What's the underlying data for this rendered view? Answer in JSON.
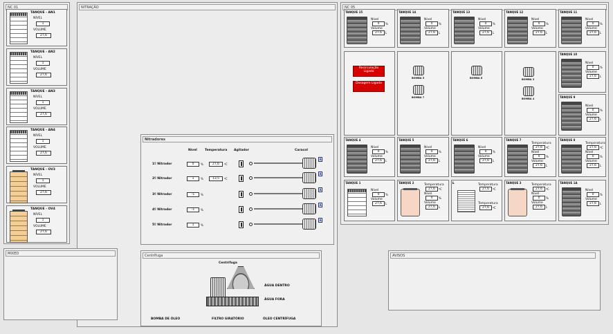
{
  "panels": {
    "left_title": "NC 01",
    "middle_title": "NITRAÇÃO",
    "right_title": "NC 05",
    "nitradores_title": "Nitradores",
    "centrifuga_title": "Centrífuga",
    "bottom_left_title": "MIXED",
    "avisos_title": "AVISOS"
  },
  "left_tanks": [
    {
      "name": "TANQUE - AN1",
      "nivel_label": "NÍVEL",
      "nivel": "1",
      "volume_label": "VOLUME",
      "volume": "27,6"
    },
    {
      "name": "TANQUE - AN2",
      "nivel_label": "NÍVEL",
      "nivel": "1",
      "volume_label": "VOLUME",
      "volume": "27,6"
    },
    {
      "name": "TANQUE - AN3",
      "nivel_label": "NÍVEL",
      "nivel": "1",
      "volume_label": "VOLUME",
      "volume": "27,6"
    },
    {
      "name": "TANQUE - AN4",
      "nivel_label": "NÍVEL",
      "nivel": "1",
      "volume_label": "VOLUME",
      "volume": "27,6"
    },
    {
      "name": "TANQUE - OV3",
      "nivel_label": "NÍVEL",
      "nivel": "1",
      "volume_label": "VOLUME",
      "volume": "27,6"
    },
    {
      "name": "TANQUE - OV4",
      "nivel_label": "NÍVEL",
      "nivel": "1",
      "volume_label": "VOLUME",
      "volume": "27,6"
    }
  ],
  "nitradores": {
    "col_nivel": "Nível",
    "col_temp": "Temperatura",
    "col_agit": "Agitador",
    "col_caracol": "Caracol",
    "rows": [
      {
        "label": "1º Nitrador",
        "nivel": "0",
        "nivel_unit": "%",
        "temp": "27,6",
        "temp_unit": "ºC",
        "a": "A"
      },
      {
        "label": "2º Nitrador",
        "nivel": "1",
        "nivel_unit": "%",
        "temp": "13,5",
        "temp_unit": "ºC",
        "a": "A"
      },
      {
        "label": "3º Nitrador",
        "nivel": "-1",
        "nivel_unit": "%",
        "temp": "",
        "temp_unit": "",
        "a": "A"
      },
      {
        "label": "4º Nitrador",
        "nivel": "-1",
        "nivel_unit": "%",
        "temp": "",
        "temp_unit": "",
        "a": "A"
      },
      {
        "label": "5º Nitrador",
        "nivel": "1",
        "nivel_unit": "%",
        "temp": "",
        "temp_unit": "",
        "a": "A"
      }
    ]
  },
  "centrifuga": {
    "label": "Centrífuga",
    "agua_dentro": "ÁGUA DENTRO",
    "agua_fora": "ÁGUA FORA",
    "bomba": "BOMBA DE ÓLEO",
    "filtro": "FILTRO GIRATÓRIO",
    "oleo": "ÓLEO CENTRÍFUGA"
  },
  "right": {
    "row1": [
      {
        "name": "TANQUE 15",
        "nivel_label": "Nível",
        "nivel": "0",
        "nivel_unit": "%",
        "volume_label": "Volume",
        "volume": "27,6",
        "volume_unit": "L"
      },
      {
        "name": "TANQUE 14",
        "nivel_label": "Nível",
        "nivel": "0",
        "nivel_unit": "%",
        "volume_label": "Volume",
        "volume": "27,6",
        "volume_unit": "L"
      },
      {
        "name": "TANQUE 13",
        "nivel_label": "Nível",
        "nivel": "0",
        "nivel_unit": "%",
        "volume_label": "Volume",
        "volume": "27,6",
        "volume_unit": "L"
      },
      {
        "name": "TANQUE 12",
        "nivel_label": "Nível",
        "nivel": "0",
        "nivel_unit": "%",
        "volume_label": "Volume",
        "volume": "27,6",
        "volume_unit": "L"
      },
      {
        "name": "TANQUE 11",
        "nivel_label": "Nível",
        "nivel": "0",
        "nivel_unit": "%",
        "volume_label": "Volume",
        "volume": "27,6",
        "volume_unit": "L"
      }
    ],
    "side": [
      {
        "name": "TANQUE 10",
        "nivel_label": "Nível",
        "nivel": "0",
        "nivel_unit": "%",
        "volume_label": "Volume",
        "volume": "27,6",
        "volume_unit": "L"
      },
      {
        "name": "TANQUE 9",
        "nivel_label": "Nível",
        "nivel": "0",
        "nivel_unit": "%",
        "volume_label": "Volume",
        "volume": "27,6",
        "volume_unit": "L"
      }
    ],
    "buttons": {
      "recirc": "Recirculação Ligada",
      "dosagem": "Dosagem Ligada"
    },
    "pumps": [
      "BOMBA 5",
      "BOMBA 7",
      "BOMBA 6",
      "BOMBA 3",
      "BOMBA 4"
    ],
    "row3": [
      {
        "name": "TANQUE 4",
        "nivel_label": "Nível",
        "nivel": "0",
        "nivel_unit": "%",
        "volume_label": "Volume",
        "volume": "27,6",
        "volume_unit": "L"
      },
      {
        "name": "TANQUE 5",
        "nivel_label": "Nível",
        "nivel": "0",
        "nivel_unit": "%",
        "volume_label": "Volume",
        "volume": "27,6",
        "volume_unit": "L"
      },
      {
        "name": "TANQUE 6",
        "nivel_label": "Nível",
        "nivel": "0",
        "nivel_unit": "%",
        "volume_label": "Volume",
        "volume": "27,6",
        "volume_unit": "L"
      },
      {
        "name": "TANQUE 7",
        "temp_label": "Temperatura",
        "temp": "27,6",
        "temp_unit": "ºC",
        "nivel_label": "Nível",
        "nivel": "0",
        "nivel_unit": "%",
        "volume_label": "Volume",
        "volume": "27,6",
        "volume_unit": "L"
      },
      {
        "name": "TANQUE 8",
        "temp_label": "Temperatura",
        "temp": "27,6",
        "temp_unit": "ºC",
        "nivel_label": "Nível",
        "nivel": "0",
        "nivel_unit": "%",
        "volume_label": "Volume",
        "volume": "27,6",
        "volume_unit": "L"
      }
    ],
    "row4": [
      {
        "name": "TANQUE 1",
        "nivel_label": "Nível",
        "nivel": "0",
        "nivel_unit": "%",
        "volume_label": "Volume",
        "volume": "27,6",
        "volume_unit": "L"
      },
      {
        "name": "TANQUE 2",
        "temp_label": "Temperatura",
        "temp": "27,6",
        "temp_unit": "ºC",
        "nivel_label": "Nível",
        "nivel": "0",
        "nivel_unit": "%",
        "volume_label": "Volume",
        "volume": "27,6",
        "volume_unit": "L"
      },
      {
        "name": "L",
        "temp_label": "Temperatura",
        "temp": "27,6",
        "temp_unit": "ºC",
        "temp2_label": "Temperatura",
        "temp2": "27,6",
        "temp2_unit": "ºC"
      },
      {
        "name": "TANQUE 3",
        "temp_label": "Temperatura",
        "temp": "27,6",
        "temp_unit": "ºC",
        "nivel_label": "Nível",
        "nivel": "0",
        "nivel_unit": "%",
        "volume_label": "Volume",
        "volume": "27,6",
        "volume_unit": "L"
      },
      {
        "name": "TANQUE 1A",
        "nivel_label": "Nível",
        "nivel": "0",
        "nivel_unit": "%",
        "volume_label": "Volume",
        "volume": "27,6",
        "volume_unit": "L"
      }
    ]
  }
}
